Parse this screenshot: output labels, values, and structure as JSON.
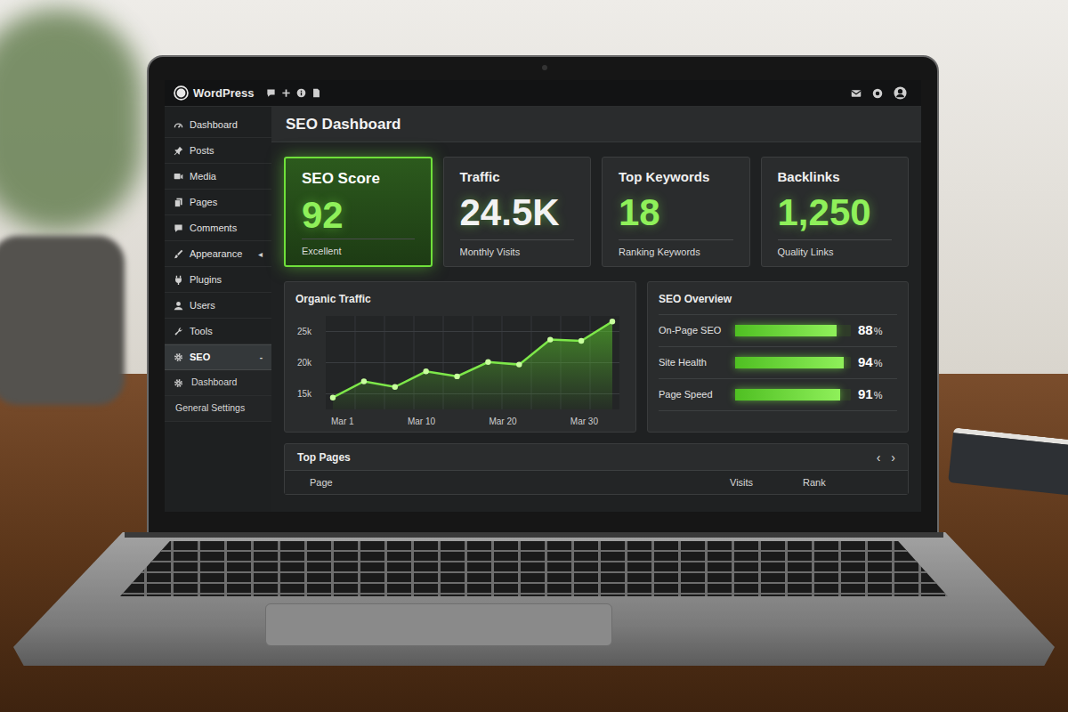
{
  "topbar": {
    "logo": "WordPress"
  },
  "sidebar": {
    "items": [
      {
        "label": "Dashboard",
        "kind": "menu",
        "selected": false
      },
      {
        "label": "Posts",
        "kind": "menu",
        "selected": false
      },
      {
        "label": "Media",
        "kind": "menu",
        "selected": false
      },
      {
        "label": "Pages",
        "kind": "menu",
        "selected": false
      },
      {
        "label": "Comments",
        "kind": "menu",
        "selected": false
      },
      {
        "label": "Appearance",
        "kind": "menu",
        "selected": false,
        "arrow": "◂"
      },
      {
        "label": "Plugins",
        "kind": "menu",
        "selected": false
      },
      {
        "label": "Users",
        "kind": "menu",
        "selected": false
      },
      {
        "label": "Tools",
        "kind": "menu",
        "selected": false
      },
      {
        "label": "SEO",
        "kind": "menu",
        "selected": true,
        "arrow": "-"
      },
      {
        "label": "Dashboard",
        "kind": "submenu",
        "selected": false
      },
      {
        "label": "General Settings",
        "kind": "submenu",
        "selected": false
      }
    ]
  },
  "page": {
    "title": "SEO Dashboard"
  },
  "stat_cards": [
    {
      "title": "SEO Score",
      "value": "92",
      "caption": "Excellent",
      "selected": true,
      "color": "#8ff05a"
    },
    {
      "title": "Traffic",
      "value": "24.5K",
      "caption": "Monthly Visits",
      "selected": false,
      "color": "#f2f2f2"
    },
    {
      "title": "Top Keywords",
      "value": "18",
      "caption": "Ranking Keywords",
      "selected": false,
      "color": "#8ff05a"
    },
    {
      "title": "Backlinks",
      "value": "1,250",
      "caption": "Quality Links",
      "selected": false,
      "color": "#8ff05a"
    }
  ],
  "chart": {
    "title": "Organic Traffic",
    "y_ticks": [
      "25k",
      "20k",
      "15k"
    ],
    "x_ticks": [
      "Mar 1",
      "Mar 10",
      "Mar 20",
      "Mar 30"
    ],
    "series": [
      {
        "values": [
          14.4,
          17.0,
          16.1,
          18.6,
          17.8,
          20.1,
          19.7,
          23.7,
          23.5,
          26.6
        ]
      }
    ]
  },
  "overview": {
    "title": "SEO Overview",
    "rows": [
      {
        "label": "On-Page SEO",
        "level": 0.88,
        "reading": "88",
        "unit": "%"
      },
      {
        "label": "Site Health",
        "level": 0.94,
        "reading": "94",
        "unit": "%"
      },
      {
        "label": "Page Speed",
        "level": 0.91,
        "reading": "91",
        "unit": "%"
      }
    ]
  },
  "top_pages": {
    "title": "Top Pages",
    "nav": [
      "‹",
      "›"
    ],
    "columns": [
      "Page",
      "Visits",
      "Rank"
    ]
  }
}
